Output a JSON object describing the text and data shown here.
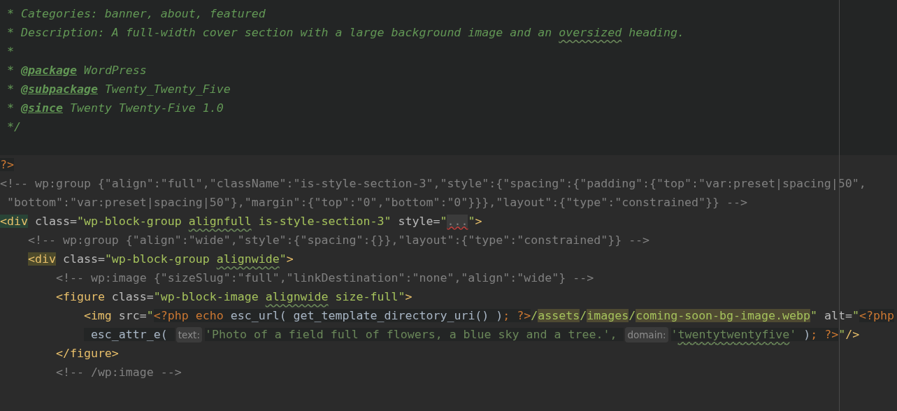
{
  "editor": {
    "doc_block": {
      "lines": [
        {
          "tokens": [
            {
              "kind": "doc",
              "text": " * Categories: banner, about, featured"
            }
          ]
        },
        {
          "tokens": [
            {
              "kind": "doc",
              "text": " * Description: A full-width cover section with a large background image and an "
            },
            {
              "kind": "doc-typo",
              "text": "oversized"
            },
            {
              "kind": "doc",
              "text": " heading."
            }
          ]
        },
        {
          "tokens": [
            {
              "kind": "doc",
              "text": " *"
            }
          ]
        },
        {
          "tokens": [
            {
              "kind": "doc",
              "text": " * "
            },
            {
              "kind": "doc-tag",
              "text": "@package"
            },
            {
              "kind": "doc",
              "text": " WordPress"
            }
          ]
        },
        {
          "tokens": [
            {
              "kind": "doc",
              "text": " * "
            },
            {
              "kind": "doc-tag",
              "text": "@subpackage"
            },
            {
              "kind": "doc",
              "text": " Twenty_Twenty_Five"
            }
          ]
        },
        {
          "tokens": [
            {
              "kind": "doc",
              "text": " * "
            },
            {
              "kind": "doc-tag",
              "text": "@since"
            },
            {
              "kind": "doc",
              "text": " Twenty Twenty-Five 1.0"
            }
          ]
        },
        {
          "tokens": [
            {
              "kind": "doc",
              "text": " */"
            }
          ]
        }
      ]
    },
    "markup_block": {
      "lines": [
        {
          "tokens": [
            {
              "kind": "php-delim",
              "text": "?>"
            }
          ]
        },
        {
          "tokens": [
            {
              "kind": "comment",
              "text": "<!-- wp:group {\"align\":\"full\",\"className\":\"is-style-section-3\",\"style\":{\"spacing\":{\"padding\":{\"top\":\"var:preset|spacing|50\","
            }
          ]
        },
        {
          "tokens": [
            {
              "kind": "comment",
              "text": " \"bottom\":\"var:preset|spacing|50\"},\"margin\":{\"top\":\"0\",\"bottom\":\"0\"}}},\"layout\":{\"type\":\"constrained\"}} -->"
            }
          ]
        },
        {
          "tokens": [
            {
              "kind": "tag-match",
              "text": "<div"
            },
            {
              "kind": "attr",
              "text": " class="
            },
            {
              "kind": "str",
              "text": "\"wp-block-group "
            },
            {
              "kind": "str-typo",
              "text": "alignfull"
            },
            {
              "kind": "str",
              "text": " is-style-section-3\""
            },
            {
              "kind": "attr",
              "text": " style="
            },
            {
              "kind": "str",
              "text": "\""
            },
            {
              "kind": "fold",
              "text": "..."
            },
            {
              "kind": "str",
              "text": "\""
            },
            {
              "kind": "tag",
              "text": ">"
            }
          ]
        },
        {
          "tokens": [
            {
              "kind": "comment",
              "text": "    <!-- wp:group {\"align\":\"wide\",\"style\":{\"spacing\":{}},\"layout\":{\"type\":\"constrained\"}} -->"
            }
          ]
        },
        {
          "tokens": [
            {
              "kind": "tag-match-alt",
              "text": "    <div"
            },
            {
              "kind": "attr",
              "text": " class="
            },
            {
              "kind": "str",
              "text": "\"wp-block-group "
            },
            {
              "kind": "str-typo",
              "text": "alignwide"
            },
            {
              "kind": "str",
              "text": "\""
            },
            {
              "kind": "tag",
              "text": ">"
            }
          ]
        },
        {
          "tokens": [
            {
              "kind": "comment",
              "text": "        <!-- wp:image {\"sizeSlug\":\"full\",\"linkDestination\":\"none\",\"align\":\"wide\"} -->"
            }
          ]
        },
        {
          "tokens": [
            {
              "kind": "tag",
              "text": "        <figure"
            },
            {
              "kind": "attr",
              "text": " class="
            },
            {
              "kind": "str",
              "text": "\"wp-block-image "
            },
            {
              "kind": "str-typo",
              "text": "alignwide"
            },
            {
              "kind": "str",
              "text": " size-full\""
            },
            {
              "kind": "tag",
              "text": ">"
            }
          ]
        },
        {
          "tokens": [
            {
              "kind": "tag",
              "text": "            <img"
            },
            {
              "kind": "attr",
              "text": " src="
            },
            {
              "kind": "str",
              "text": "\""
            },
            {
              "kind": "php-kw",
              "text": "<?php echo"
            },
            {
              "kind": "php-fn",
              "text": " esc_url( get_template_directory_uri() )"
            },
            {
              "kind": "php-kw",
              "text": "; ?>"
            },
            {
              "kind": "str",
              "text": "/"
            },
            {
              "kind": "path",
              "text": "assets"
            },
            {
              "kind": "str",
              "text": "/"
            },
            {
              "kind": "path",
              "text": "images"
            },
            {
              "kind": "str",
              "text": "/"
            },
            {
              "kind": "path",
              "text": "coming-soon-bg-image.webp"
            },
            {
              "kind": "str",
              "text": "\""
            },
            {
              "kind": "attr",
              "text": " alt="
            },
            {
              "kind": "str",
              "text": "\""
            },
            {
              "kind": "php-kw",
              "text": "<?php"
            }
          ]
        },
        {
          "tokens": [
            {
              "kind": "php-fn",
              "text": "             esc_attr_e( "
            },
            {
              "kind": "hint",
              "text": "text:"
            },
            {
              "kind": "php-str",
              "text": "'Photo of a field full of flowers, a blue sky and a tree.', "
            },
            {
              "kind": "hint",
              "text": "domain:"
            },
            {
              "kind": "php-str",
              "text": "'"
            },
            {
              "kind": "php-str-typo",
              "text": "twentytwentyfive"
            },
            {
              "kind": "php-str",
              "text": "'"
            },
            {
              "kind": "php-fn",
              "text": " )"
            },
            {
              "kind": "php-kw",
              "text": "; ?>"
            },
            {
              "kind": "str",
              "text": "\""
            },
            {
              "kind": "tag",
              "text": "/>"
            }
          ]
        },
        {
          "tokens": [
            {
              "kind": "tag",
              "text": "        </figure>"
            }
          ]
        },
        {
          "tokens": [
            {
              "kind": "comment",
              "text": "        <!-- /wp:image -->"
            }
          ]
        }
      ]
    }
  }
}
